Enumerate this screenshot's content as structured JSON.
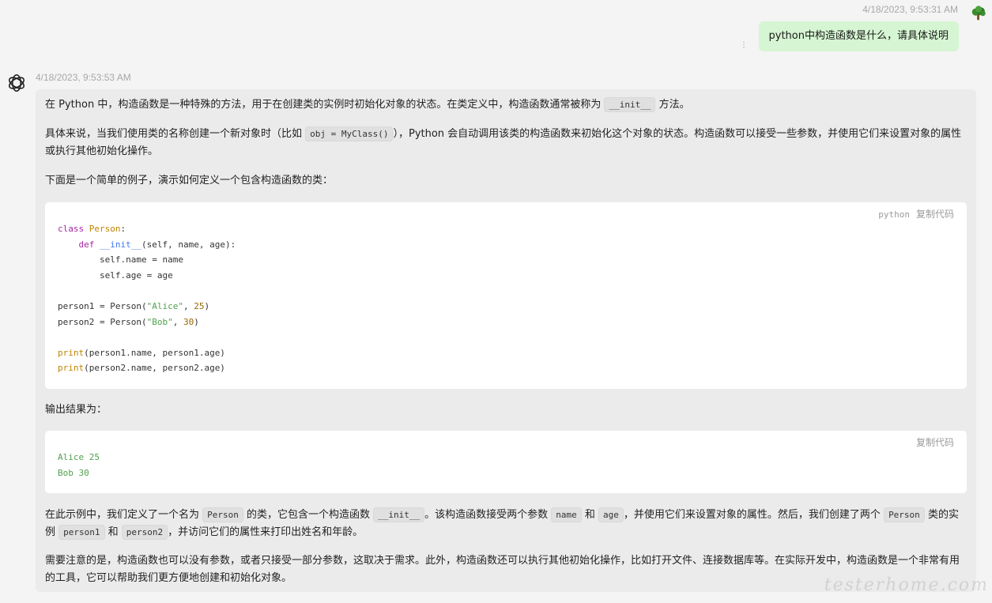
{
  "user": {
    "timestamp": "4/18/2023, 9:53:31 AM",
    "message": "python中构造函数是什么，请具体说明"
  },
  "assistant": {
    "timestamp": "4/18/2023, 9:53:53 AM",
    "p1": [
      "在 Python 中，构造函数是一种特殊的方法，用于在创建类的实例时初始化对象的状态。在类定义中，构造函数通常被称为 ",
      "__init__",
      " 方法。"
    ],
    "p2": [
      "具体来说，当我们使用类的名称创建一个新对象时（比如 ",
      "obj = MyClass()",
      "），Python 会自动调用该类的构造函数来初始化这个对象的状态。构造函数可以接受一些参数，并使用它们来设置对象的属性或执行其他初始化操作。"
    ],
    "p3": "下面是一个简单的例子，演示如何定义一个包含构造函数的类：",
    "code1": {
      "lang": "python",
      "copy": "复制代码",
      "tokens": {
        "class_kw": "class",
        "class_name": "Person",
        "def_kw": "def",
        "init_name": "__init__",
        "print_kw": "print",
        "alice": "\"Alice\"",
        "bob": "\"Bob\"",
        "n25": "25",
        "n30": "30"
      }
    },
    "p4": "输出结果为：",
    "code2": {
      "copy": "复制代码",
      "lines": [
        "Alice 25",
        "Bob 30"
      ]
    },
    "p5": [
      "在此示例中，我们定义了一个名为 ",
      "Person",
      " 的类，它包含一个构造函数 ",
      "__init__",
      "。该构造函数接受两个参数 ",
      "name",
      " 和 ",
      "age",
      "，并使用它们来设置对象的属性。然后，我们创建了两个 ",
      "Person",
      " 类的实例 ",
      "person1",
      " 和 ",
      "person2",
      "，并访问它们的属性来打印出姓名和年龄。"
    ],
    "p6": "需要注意的是，构造函数也可以没有参数，或者只接受一部分参数，这取决于需求。此外，构造函数还可以执行其他初始化操作，比如打开文件、连接数据库等。在实际开发中，构造函数是一个非常有用的工具，它可以帮助我们更方便地创建和初始化对象。"
  },
  "watermark": "testerhome.com",
  "icons": {
    "user_avatar": "tree-icon",
    "assistant_avatar": "openai-logo-icon",
    "more": "kebab-icon"
  }
}
